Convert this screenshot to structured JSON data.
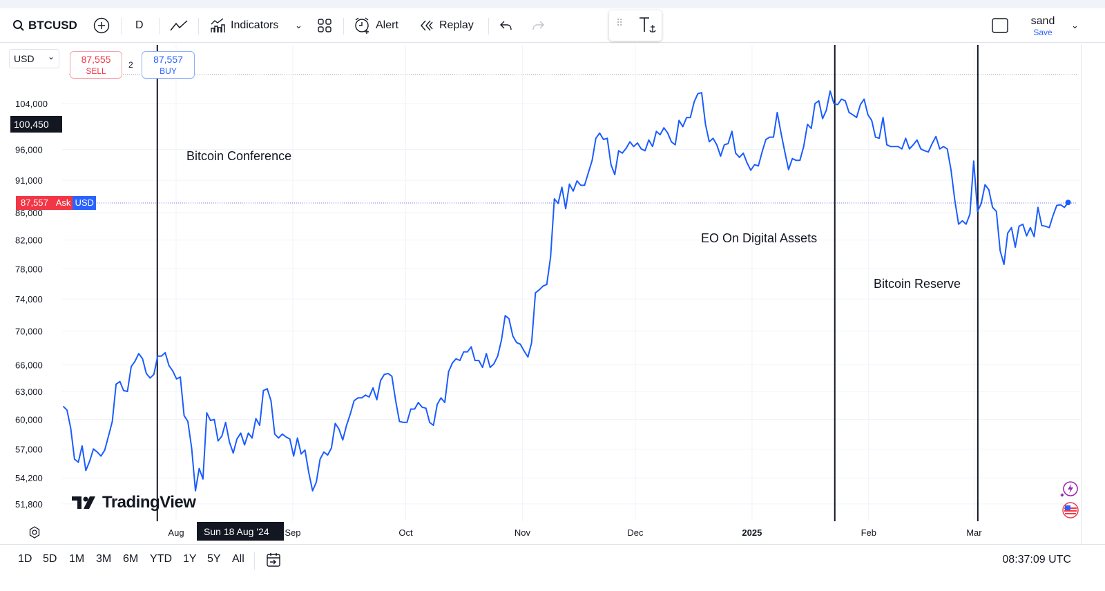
{
  "toolbar": {
    "symbol": "BTCUSD",
    "interval": "D",
    "indicators_label": "Indicators",
    "alert_label": "Alert",
    "replay_label": "Replay",
    "layout_name": "sand",
    "save_label": "Save"
  },
  "chart_header": {
    "currency": "USD",
    "sell_price": "87,555",
    "sell_label": "SELL",
    "spread": "2",
    "buy_price": "87,557",
    "buy_label": "BUY"
  },
  "crosshair": {
    "price_label": "100,450",
    "date_label": "Sun 18 Aug '24"
  },
  "last_price": {
    "price": "87,557",
    "side": "Ask",
    "currency": "USD"
  },
  "watermark": "TradingView",
  "bottom": {
    "ranges": [
      "1D",
      "5D",
      "1M",
      "3M",
      "6M",
      "YTD",
      "1Y",
      "5Y",
      "All"
    ],
    "clock": "08:37:09 UTC"
  },
  "colors": {
    "line": "#1a5cff",
    "sell": "#f23645",
    "buy": "#2962ff"
  },
  "chart_data": {
    "type": "line",
    "title": "BTCUSD",
    "scale": "log",
    "x_start": "2024-07-02",
    "x_end": "2025-03-26",
    "ylim": [
      51000,
      108000
    ],
    "y_ticks": [
      104000,
      96000,
      91000,
      86000,
      82000,
      78000,
      74000,
      70000,
      66000,
      63000,
      60000,
      57000,
      54200,
      51800
    ],
    "y_tick_labels": [
      "104,000",
      "96,000",
      "91,000",
      "86,000",
      "82,000",
      "78,000",
      "74,000",
      "70,000",
      "66,000",
      "63,000",
      "60,000",
      "57,000",
      "54,200",
      "51,800"
    ],
    "x_ticks": [
      {
        "label": "Aug",
        "date": "2024-08-01"
      },
      {
        "label": "Sep",
        "date": "2024-09-01"
      },
      {
        "label": "Oct",
        "date": "2024-10-01"
      },
      {
        "label": "Nov",
        "date": "2024-11-01"
      },
      {
        "label": "Dec",
        "date": "2024-12-01"
      },
      {
        "label": "2025",
        "date": "2025-01-01",
        "bold": true
      },
      {
        "label": "Feb",
        "date": "2025-02-01"
      },
      {
        "label": "Mar",
        "date": "2025-03-01"
      }
    ],
    "events": [
      {
        "label": "Bitcoin Conference",
        "date": "2024-07-27"
      },
      {
        "label": "EO On Digital Assets",
        "date": "2025-01-23"
      },
      {
        "label": "Bitcoin Reserve",
        "date": "2025-03-02"
      }
    ],
    "series": [
      {
        "name": "BTCUSD",
        "values": [
          61400,
          61000,
          59100,
          56000,
          55700,
          57300,
          54900,
          55800,
          57000,
          56700,
          56300,
          56900,
          58300,
          59800,
          63800,
          64100,
          63100,
          63000,
          65800,
          66400,
          67300,
          66700,
          65000,
          64500,
          64900,
          67000,
          67000,
          67400,
          65900,
          65300,
          64400,
          64600,
          60400,
          59800,
          57100,
          53000,
          55100,
          54100,
          60700,
          59900,
          60000,
          57800,
          58300,
          59700,
          57700,
          56600,
          58000,
          58600,
          57400,
          58600,
          58100,
          60100,
          59400,
          63100,
          63300,
          62000,
          58500,
          58100,
          58500,
          58200,
          58000,
          56300,
          58100,
          56500,
          56900,
          54700,
          53000,
          53800,
          56000,
          56700,
          56400,
          57100,
          59600,
          59000,
          57900,
          59400,
          60600,
          62000,
          62300,
          62300,
          62600,
          62400,
          63400,
          62100,
          64200,
          64900,
          65000,
          64700,
          62000,
          59800,
          59700,
          59700,
          61100,
          61100,
          61800,
          61300,
          61200,
          59700,
          59400,
          61600,
          62300,
          61800,
          65200,
          66200,
          66700,
          66500,
          67500,
          67500,
          68100,
          66500,
          66500,
          65700,
          67300,
          65700,
          66100,
          67000,
          68900,
          71900,
          71500,
          69400,
          68600,
          68400,
          67600,
          66900,
          68600,
          74800,
          75200,
          75700,
          75900,
          79600,
          88100,
          87400,
          89900,
          86600,
          90400,
          89300,
          90900,
          90200,
          90200,
          92200,
          94200,
          97900,
          98800,
          97700,
          97900,
          93500,
          91900,
          95800,
          95400,
          96200,
          97300,
          96500,
          97100,
          96100,
          95800,
          97600,
          96500,
          99100,
          98500,
          99700,
          98800,
          97300,
          96800,
          101000,
          99900,
          101500,
          101500,
          104300,
          105800,
          106000,
          100300,
          97300,
          97900,
          96800,
          94900,
          96800,
          97000,
          99100,
          95400,
          94700,
          95400,
          93800,
          92600,
          93500,
          93300,
          95600,
          97700,
          98100,
          98100,
          102400,
          98800,
          95600,
          92700,
          94500,
          94200,
          94200,
          96500,
          100300,
          99600,
          104000,
          104500,
          101300,
          102800,
          106300,
          104000,
          103800,
          104800,
          104500,
          102400,
          102000,
          101500,
          103800,
          104800,
          102000,
          101000,
          98100,
          97900,
          101500,
          96800,
          96500,
          96500,
          96500,
          96100,
          97900,
          96100,
          96800,
          97600,
          96100,
          95800,
          95600,
          97000,
          98200,
          96100,
          96500,
          96100,
          92600,
          87900,
          84300,
          84800,
          84300,
          85800,
          94100,
          86200,
          87400,
          90300,
          89500,
          86800,
          86200,
          80500,
          78600,
          83000,
          83800,
          81000,
          84000,
          84300,
          82600,
          83800,
          82500,
          86800,
          84100,
          84000,
          83800,
          85600,
          87100,
          87200,
          86800,
          87557
        ]
      }
    ]
  }
}
